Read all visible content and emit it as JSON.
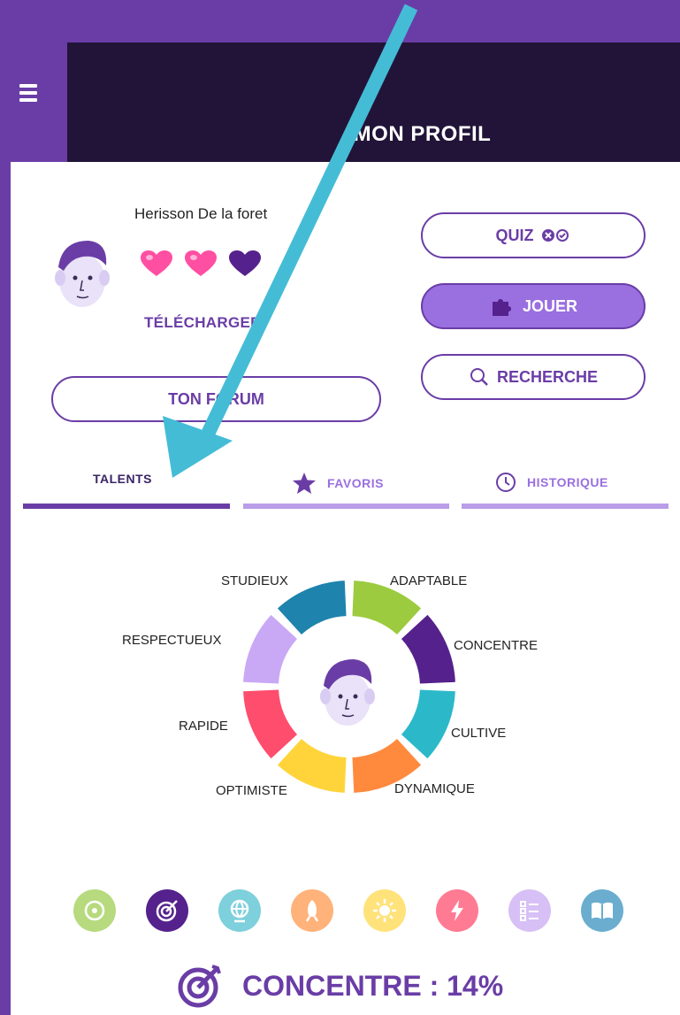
{
  "header": {
    "title": "MON PROFIL"
  },
  "profile": {
    "username": "Herisson De la foret",
    "hearts": {
      "full": 2,
      "total": 3
    },
    "download_label": "TÉLÉCHARGER",
    "forum_label": "TON FORUM"
  },
  "actions": {
    "quiz_label": "QUIZ",
    "jouer_label": "JOUER",
    "recherche_label": "RECHERCHE"
  },
  "tabs": [
    {
      "label": "TALENTS",
      "active": true
    },
    {
      "label": "FAVORIS",
      "active": false
    },
    {
      "label": "HISTORIQUE",
      "active": false
    }
  ],
  "talents": [
    {
      "label": "ADAPTABLE",
      "color": "#9ccb3f"
    },
    {
      "label": "CONCENTRE",
      "color": "#55218c"
    },
    {
      "label": "CULTIVE",
      "color": "#2bb9c9"
    },
    {
      "label": "DYNAMIQUE",
      "color": "#ff8a3d"
    },
    {
      "label": "OPTIMISTE",
      "color": "#ffd43b"
    },
    {
      "label": "RAPIDE",
      "color": "#ff4d6d"
    },
    {
      "label": "RESPECTUEUX",
      "color": "#c9a8f5"
    },
    {
      "label": "STUDIEUX",
      "color": "#1e83ad"
    }
  ],
  "talent_icons": [
    {
      "icon": "adaptable-icon",
      "color": "#b6da7d"
    },
    {
      "icon": "target-icon",
      "color": "#55218c"
    },
    {
      "icon": "globe-icon",
      "color": "#7dd0dc"
    },
    {
      "icon": "rocket-icon",
      "color": "#ffb27a"
    },
    {
      "icon": "sun-icon",
      "color": "#ffe27a"
    },
    {
      "icon": "lightning-icon",
      "color": "#ff7b93"
    },
    {
      "icon": "checklist-icon",
      "color": "#d7c0f5"
    },
    {
      "icon": "book-icon",
      "color": "#6aadcf"
    }
  ],
  "selected_talent": {
    "label": "CONCENTRE : 14%",
    "percent": 14
  },
  "colors": {
    "brand": "#6a3da6",
    "header_bg": "#221438",
    "arrow": "#45bcd6"
  }
}
